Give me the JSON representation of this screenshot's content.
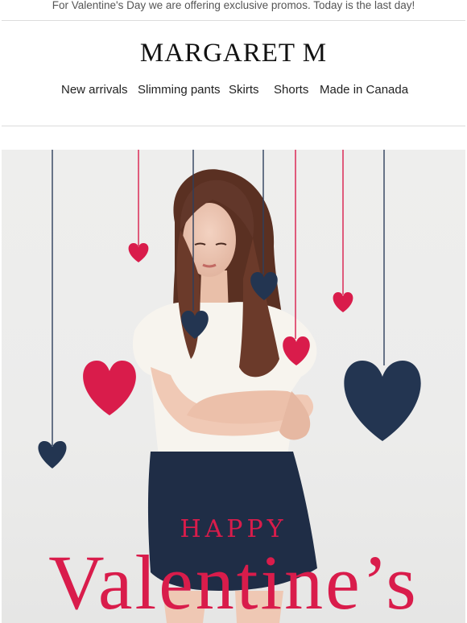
{
  "promo": {
    "text": "For Valentine's Day we are offering exclusive promos. Today is the last day!"
  },
  "header": {
    "brand": "MARGARET M"
  },
  "nav": {
    "items": [
      "New arrivals",
      "Slimming pants",
      "Skirts",
      "Shorts",
      "Made in Canada"
    ]
  },
  "hero": {
    "happy": "HAPPY",
    "valentines": "Valentine’s"
  },
  "colors": {
    "accent_red": "#d91c4b",
    "navy": "#233551",
    "hero_bg": "#eeeeed"
  }
}
